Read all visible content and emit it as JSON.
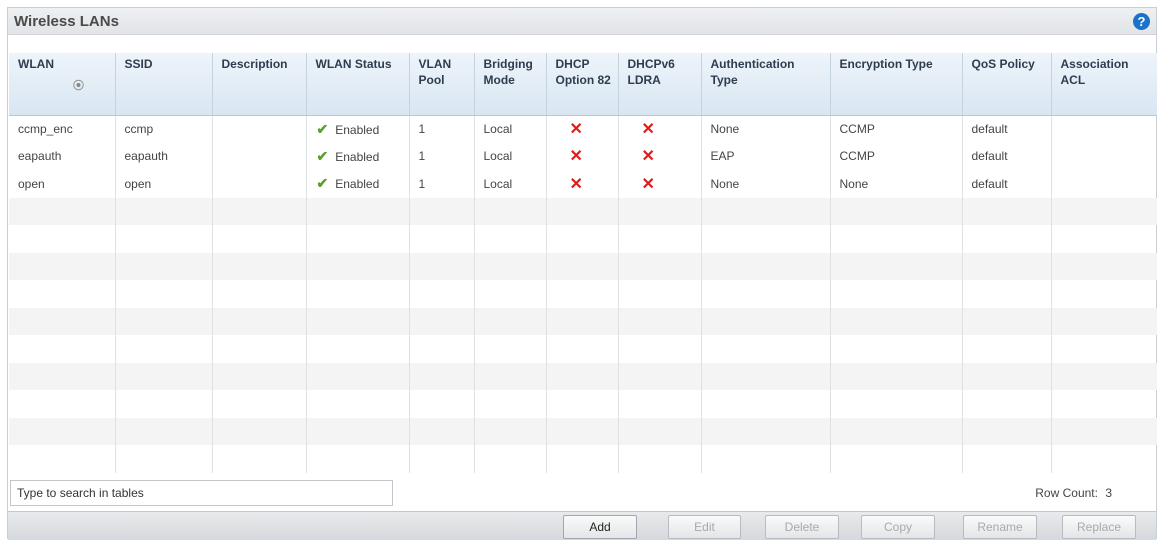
{
  "panel": {
    "title": "Wireless LANs",
    "help_icon": "?"
  },
  "table": {
    "columns": [
      "WLAN",
      "SSID",
      "Description",
      "WLAN Status",
      "VLAN Pool",
      "Bridging Mode",
      "DHCP Option 82",
      "DHCPv6 LDRA",
      "Authentication Type",
      "Encryption Type",
      "QoS Policy",
      "Association ACL"
    ],
    "sort_icon": "⦿",
    "rows": [
      {
        "wlan": "ccmp_enc",
        "ssid": "ccmp",
        "description": "",
        "status": "Enabled",
        "vlan_pool": "1",
        "bridging": "Local",
        "dhcp82": "✕",
        "dhcpv6": "✕",
        "auth": "None",
        "encryption": "CCMP",
        "qos": "default",
        "acl": ""
      },
      {
        "wlan": "eapauth",
        "ssid": "eapauth",
        "description": "",
        "status": "Enabled",
        "vlan_pool": "1",
        "bridging": "Local",
        "dhcp82": "✕",
        "dhcpv6": "✕",
        "auth": "EAP",
        "encryption": "CCMP",
        "qos": "default",
        "acl": ""
      },
      {
        "wlan": "open",
        "ssid": "open",
        "description": "",
        "status": "Enabled",
        "vlan_pool": "1",
        "bridging": "Local",
        "dhcp82": "✕",
        "dhcpv6": "✕",
        "auth": "None",
        "encryption": "None",
        "qos": "default",
        "acl": ""
      }
    ],
    "status_check": "✔"
  },
  "search": {
    "value": "Type to search in tables"
  },
  "row_count": {
    "label": "Row Count:",
    "value": "3"
  },
  "buttons": {
    "add": "Add",
    "edit": "Edit",
    "delete": "Delete",
    "copy": "Copy",
    "rename": "Rename",
    "replace": "Replace"
  }
}
